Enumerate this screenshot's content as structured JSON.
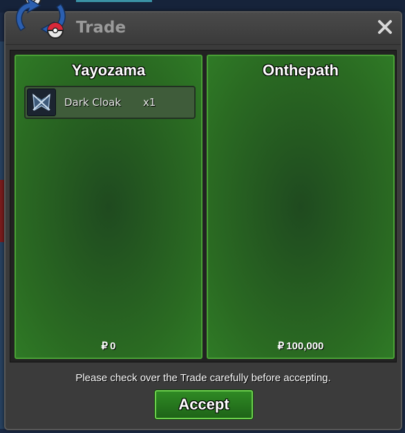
{
  "window": {
    "title": "Trade"
  },
  "left_panel": {
    "player": "Yayozama",
    "items": [
      {
        "name": "Dark Cloak",
        "quantity": "x1",
        "icon": "dark-cloak-icon"
      }
    ],
    "currency_symbol": "₽",
    "money": "0"
  },
  "right_panel": {
    "player": "Onthepath",
    "items": [],
    "currency_symbol": "₽",
    "money": "100,000"
  },
  "footer": {
    "notice": "Please check over the Trade carefully before accepting.",
    "accept_label": "Accept"
  },
  "colors": {
    "panel_green": "#2a6a22",
    "panel_border": "#4aa236",
    "window_bg": "#3b3b3b",
    "accept_green": "#2f8a24"
  }
}
